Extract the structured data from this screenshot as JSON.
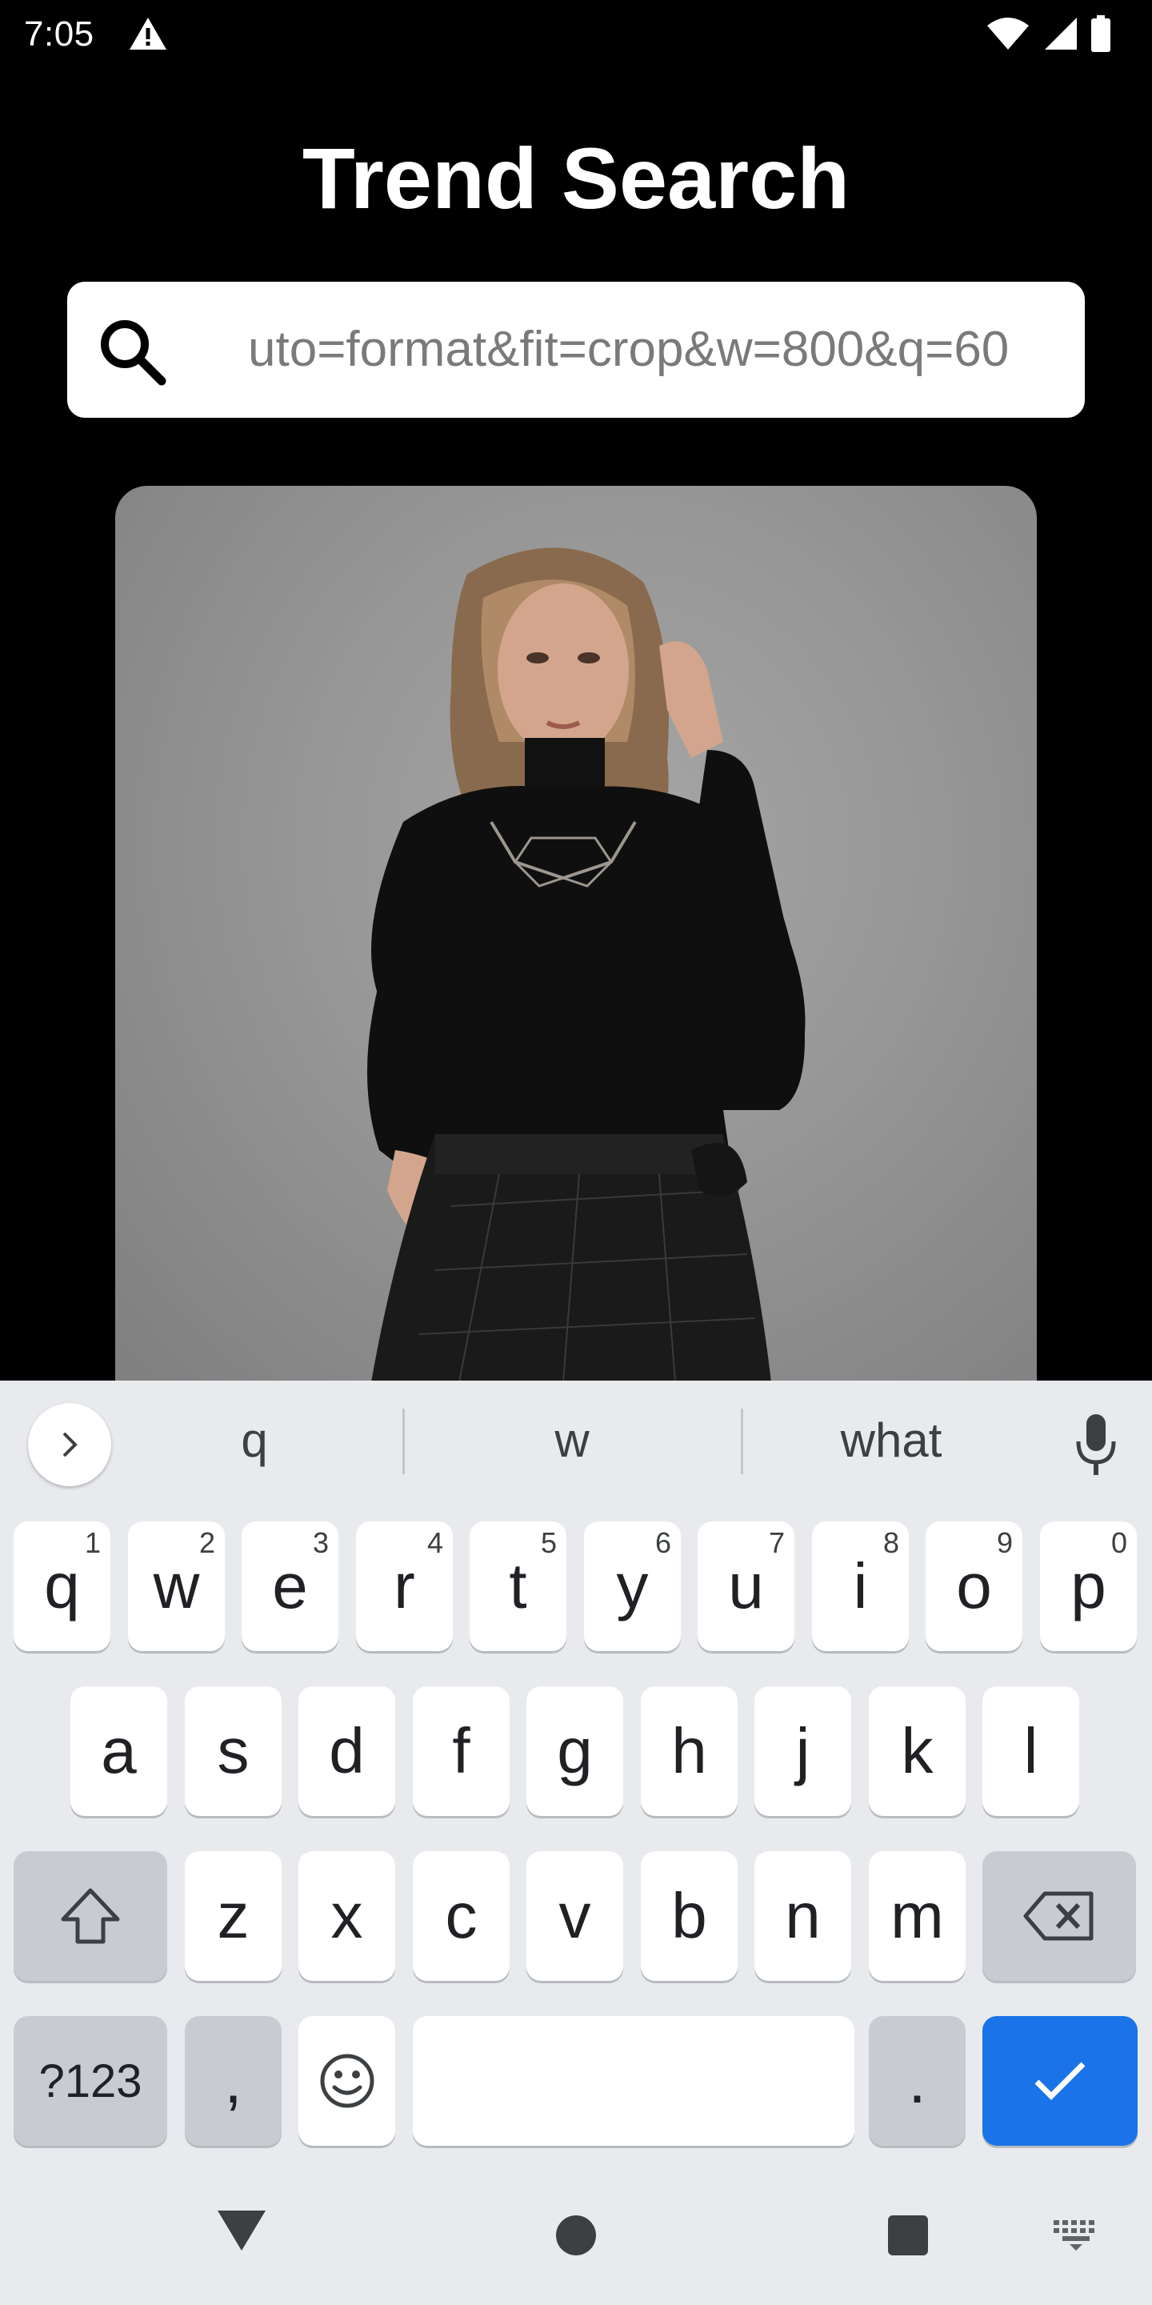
{
  "status_bar": {
    "time": "7:05",
    "icons": [
      "warning-icon",
      "wifi-icon",
      "signal-icon",
      "battery-icon"
    ]
  },
  "title": "Trend Search",
  "search": {
    "value": "uto=format&fit=crop&w=800&q=60",
    "icon": "search-icon"
  },
  "photo": {
    "description_visible": false
  },
  "keyboard": {
    "suggestions": [
      "q",
      "w",
      "what"
    ],
    "row1": [
      {
        "key": "q",
        "hint": "1"
      },
      {
        "key": "w",
        "hint": "2"
      },
      {
        "key": "e",
        "hint": "3"
      },
      {
        "key": "r",
        "hint": "4"
      },
      {
        "key": "t",
        "hint": "5"
      },
      {
        "key": "y",
        "hint": "6"
      },
      {
        "key": "u",
        "hint": "7"
      },
      {
        "key": "i",
        "hint": "8"
      },
      {
        "key": "o",
        "hint": "9"
      },
      {
        "key": "p",
        "hint": "0"
      }
    ],
    "row2": [
      "a",
      "s",
      "d",
      "f",
      "g",
      "h",
      "j",
      "k",
      "l"
    ],
    "row3": [
      "z",
      "x",
      "c",
      "v",
      "b",
      "n",
      "m"
    ],
    "row4": {
      "symbols": "?123",
      "comma": ",",
      "period": "."
    },
    "accent_color": "#1a73e8"
  },
  "nav": {
    "icons": [
      "back-icon",
      "home-icon",
      "recents-icon",
      "keyboard-switch-icon"
    ]
  }
}
